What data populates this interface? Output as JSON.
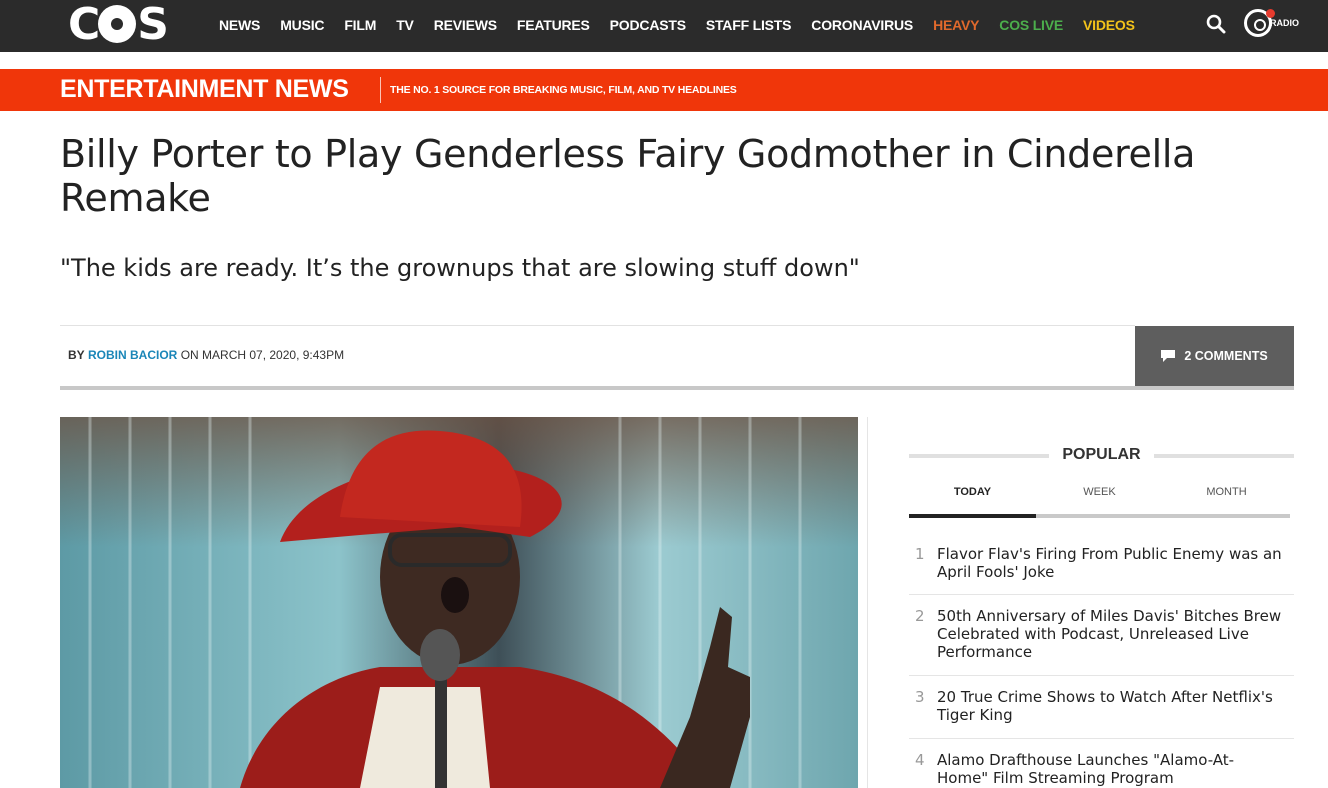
{
  "logo": {
    "text_pre": "C",
    "text_post": "S"
  },
  "nav": {
    "items": [
      "NEWS",
      "MUSIC",
      "FILM",
      "TV",
      "REVIEWS",
      "FEATURES",
      "PODCASTS",
      "STAFF LISTS",
      "CORONAVIRUS"
    ],
    "heavy": "HEAVY",
    "live": "COS LIVE",
    "videos": "VIDEOS",
    "radio_label": "RADIO",
    "colors": {
      "heavy": "#e0692c",
      "live": "#4cae4c",
      "videos": "#f2c21a",
      "bar": "#2b2b2b"
    }
  },
  "banner": {
    "section": "ENTERTAINMENT NEWS",
    "tagline": "THE NO. 1 SOURCE FOR BREAKING MUSIC, FILM, AND TV HEADLINES",
    "color": "#f0360a"
  },
  "article": {
    "headline": "Billy Porter to Play Genderless Fairy Godmother in Cinderella Remake",
    "dek": "\"The kids are ready. It’s the grownups that are slowing stuff down\"",
    "by": "BY",
    "author": "ROBIN BACIOR",
    "date": "ON MARCH 07, 2020, 9:43PM",
    "comments": "2 COMMENTS",
    "hero_image": "man-in-red-hat-singing-photo"
  },
  "popular": {
    "title": "POPULAR",
    "tabs": [
      "TODAY",
      "WEEK",
      "MONTH"
    ],
    "active_tab": "TODAY",
    "items": [
      {
        "num": "1",
        "title": "Flavor Flav's Firing From Public Enemy was an April Fools' Joke"
      },
      {
        "num": "2",
        "title": "50th Anniversary of Miles Davis' Bitches Brew Celebrated with Podcast, Unreleased Live Performance"
      },
      {
        "num": "3",
        "title": "20 True Crime Shows to Watch After Netflix's Tiger King"
      },
      {
        "num": "4",
        "title": "Alamo Drafthouse Launches \"Alamo-At-Home\" Film Streaming Program"
      }
    ]
  }
}
